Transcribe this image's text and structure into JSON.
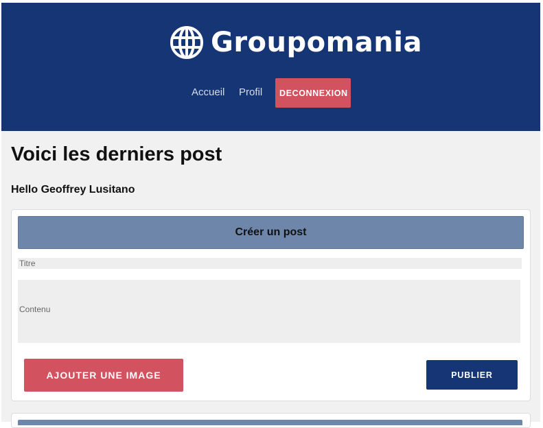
{
  "header": {
    "brand_name": "Groupomania",
    "logo_icon": "globe-icon",
    "nav": {
      "home_label": "Accueil",
      "profile_label": "Profil",
      "logout_label": "DECONNEXION"
    }
  },
  "main": {
    "page_title": "Voici les derniers post",
    "greeting": "Hello Geoffrey Lusitano",
    "create_post": {
      "header_label": "Créer un post",
      "title_placeholder": "Titre",
      "content_placeholder": "Contenu",
      "add_image_label": "AJOUTER UNE IMAGE",
      "publish_label": "PUBLIER"
    }
  },
  "colors": {
    "primary": "#153574",
    "accent": "#d3525f",
    "card_header": "#6f86ab",
    "background": "#f1f1f1"
  }
}
